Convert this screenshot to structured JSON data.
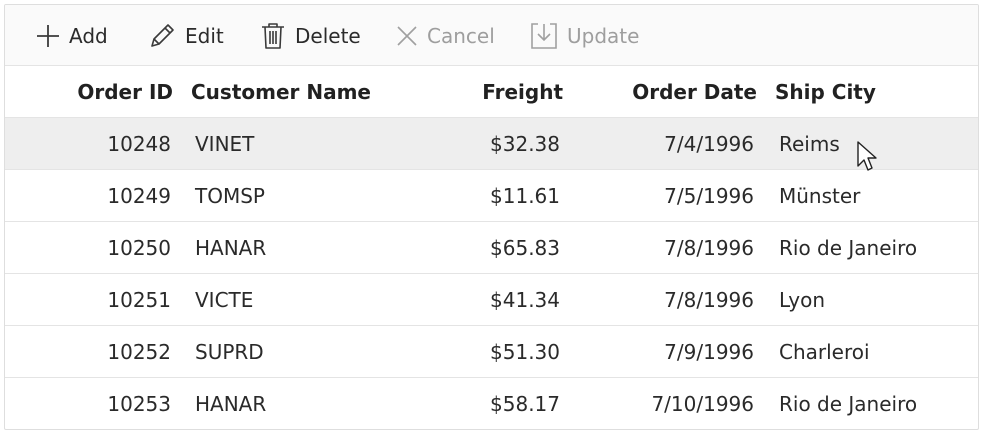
{
  "toolbar": {
    "add_label": "Add",
    "edit_label": "Edit",
    "delete_label": "Delete",
    "cancel_label": "Cancel",
    "update_label": "Update"
  },
  "columns": {
    "order_id": "Order ID",
    "customer_name": "Customer Name",
    "freight": "Freight",
    "order_date": "Order Date",
    "ship_city": "Ship City"
  },
  "rows": [
    {
      "order_id": "10248",
      "customer_name": "VINET",
      "freight": "$32.38",
      "order_date": "7/4/1996",
      "ship_city": "Reims"
    },
    {
      "order_id": "10249",
      "customer_name": "TOMSP",
      "freight": "$11.61",
      "order_date": "7/5/1996",
      "ship_city": "Münster"
    },
    {
      "order_id": "10250",
      "customer_name": "HANAR",
      "freight": "$65.83",
      "order_date": "7/8/1996",
      "ship_city": "Rio de Janeiro"
    },
    {
      "order_id": "10251",
      "customer_name": "VICTE",
      "freight": "$41.34",
      "order_date": "7/8/1996",
      "ship_city": "Lyon"
    },
    {
      "order_id": "10252",
      "customer_name": "SUPRD",
      "freight": "$51.30",
      "order_date": "7/9/1996",
      "ship_city": "Charleroi"
    },
    {
      "order_id": "10253",
      "customer_name": "HANAR",
      "freight": "$58.17",
      "order_date": "7/10/1996",
      "ship_city": "Rio de Janeiro"
    }
  ],
  "icons": {
    "add": "plus-icon",
    "edit": "pencil-icon",
    "delete": "trash-icon",
    "cancel": "close-icon",
    "update": "save-icon",
    "cursor": "mouse-pointer-icon"
  },
  "colors": {
    "hover_row": "#eeeeee",
    "disabled_text": "#9e9e9e"
  }
}
